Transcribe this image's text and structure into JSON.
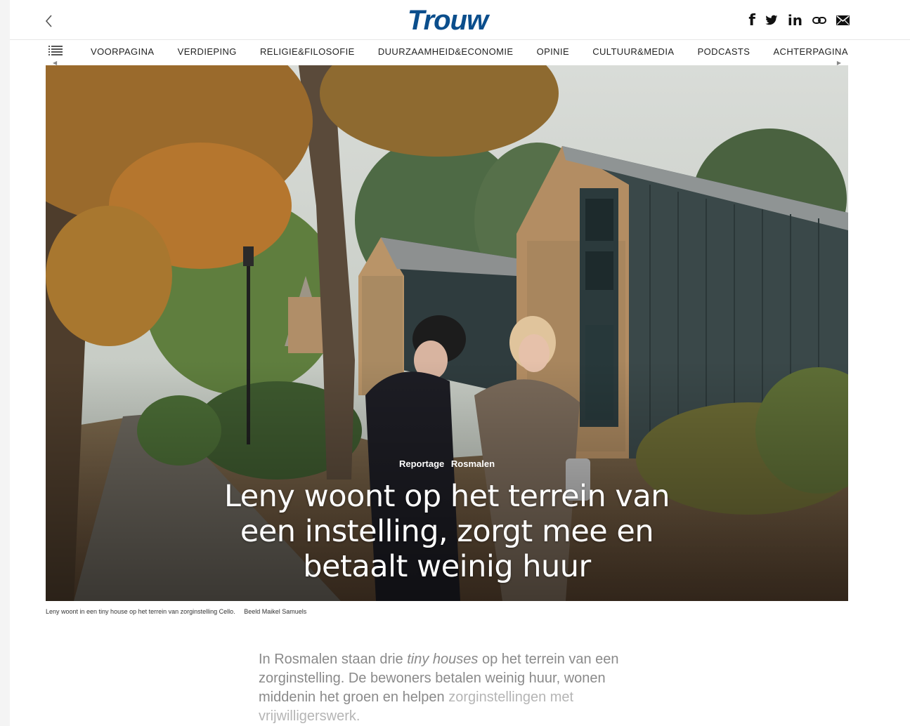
{
  "header": {
    "logo": "Trouw",
    "share": {
      "facebook": "f",
      "twitter": "twitter-icon",
      "linkedin": "in",
      "link": "link-icon",
      "mail": "mail-icon"
    }
  },
  "nav": {
    "items": [
      "VOORPAGINA",
      "VERDIEPING",
      "RELIGIE&FILOSOFIE",
      "DUURZAAMHEID&ECONOMIE",
      "OPINIE",
      "CULTUUR&MEDIA",
      "PODCASTS",
      "ACHTERPAGINA"
    ]
  },
  "article": {
    "kicker_label": "Reportage",
    "kicker_location": "Rosmalen",
    "headline": "Leny woont op het terrein van een instelling, zorgt mee en betaalt weinig huur",
    "caption": "Leny woont in een tiny house op het terrein van zorginstelling Cello.",
    "credit": "Beeld Maikel Samuels",
    "lead_before": "In Rosmalen staan drie ",
    "lead_italic": "tiny houses",
    "lead_after": " op het terrein van een zorginstelling. De bewoners betalen weinig huur, wonen middenin het groen en helpen ",
    "lead_fade": "zorginstellingen met vrijwilligerswerk."
  },
  "colors": {
    "brand": "#0b4e8c",
    "text": "#111111",
    "lead": "#8a8a8a"
  }
}
